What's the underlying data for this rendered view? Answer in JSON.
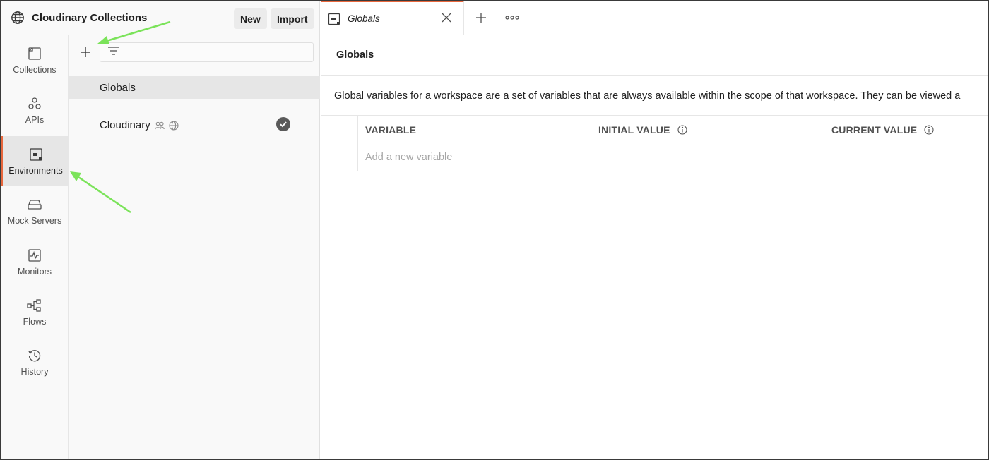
{
  "workspace": {
    "title": "Cloudinary Collections",
    "new_label": "New",
    "import_label": "Import",
    "icon": "globe-icon"
  },
  "sidebar": {
    "items": [
      {
        "label": "Collections",
        "icon": "collections-icon",
        "active": false
      },
      {
        "label": "APIs",
        "icon": "apis-icon",
        "active": false
      },
      {
        "label": "Environments",
        "icon": "environments-icon",
        "active": true
      },
      {
        "label": "Mock Servers",
        "icon": "mock-server-icon",
        "active": false
      },
      {
        "label": "Monitors",
        "icon": "monitors-icon",
        "active": false
      },
      {
        "label": "Flows",
        "icon": "flows-icon",
        "active": false
      },
      {
        "label": "History",
        "icon": "history-icon",
        "active": false
      }
    ]
  },
  "env_list": {
    "search_placeholder": "",
    "items": [
      {
        "label": "Globals",
        "selected": true
      },
      {
        "label": "Cloudinary",
        "active_check": true
      }
    ]
  },
  "tabs": [
    {
      "label": "Globals",
      "icon": "environment-tab-icon"
    }
  ],
  "main": {
    "title": "Globals",
    "description": "Global variables for a workspace are a set of variables that are always available within the scope of that workspace. They can be viewed a",
    "table": {
      "columns": [
        "VARIABLE",
        "INITIAL VALUE",
        "CURRENT VALUE"
      ],
      "new_row_placeholder": "Add a new variable"
    }
  },
  "colors": {
    "accent": "#e8673c",
    "annotation_arrow": "#7be35a",
    "active_bg": "#e6e6e6"
  }
}
